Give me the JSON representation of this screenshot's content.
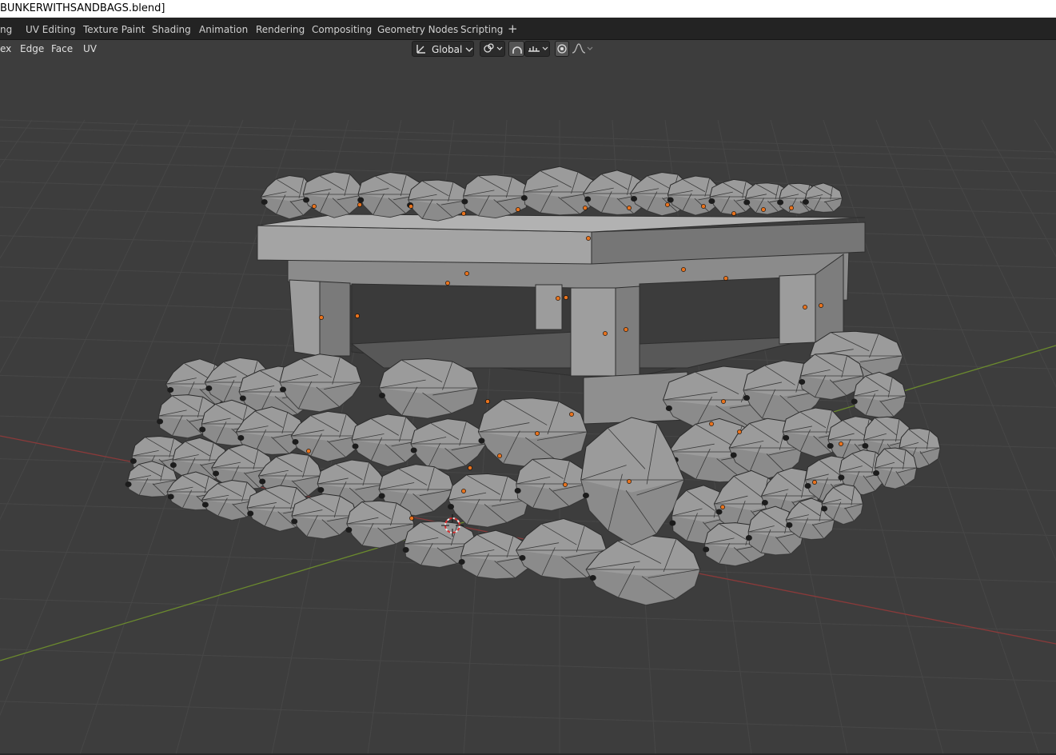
{
  "window": {
    "title": "BUNKERWITHSANDBAGS.blend]"
  },
  "workspace_tabs": [
    {
      "label": "ng"
    },
    {
      "label": "UV Editing"
    },
    {
      "label": "Texture Paint"
    },
    {
      "label": "Shading"
    },
    {
      "label": "Animation"
    },
    {
      "label": "Rendering"
    },
    {
      "label": "Compositing"
    },
    {
      "label": "Geometry Nodes"
    },
    {
      "label": "Scripting"
    },
    {
      "label": "+"
    }
  ],
  "header_menu": [
    {
      "label": "ex"
    },
    {
      "label": "Edge"
    },
    {
      "label": "Face"
    },
    {
      "label": "UV"
    }
  ],
  "transform_orientation": {
    "value": "Global"
  },
  "icons": {
    "orientation": "transform-orientation-icon",
    "pivot": "pivot-point-icon",
    "snap": "snap-icon",
    "snap_target": "snap-increment-icon",
    "proportional": "proportional-editing-icon",
    "falloff": "falloff-curve-icon",
    "cursor": "3d-cursor-icon"
  },
  "colors": {
    "viewport_bg": "#3d3d3d",
    "grid_line": "#474747",
    "x_axis": "#8a3a3a",
    "y_axis": "#6b8a2e",
    "mesh_face": "#9a9a9a",
    "wire": "#2a2a2a",
    "origin_dot": "#e8731e"
  }
}
